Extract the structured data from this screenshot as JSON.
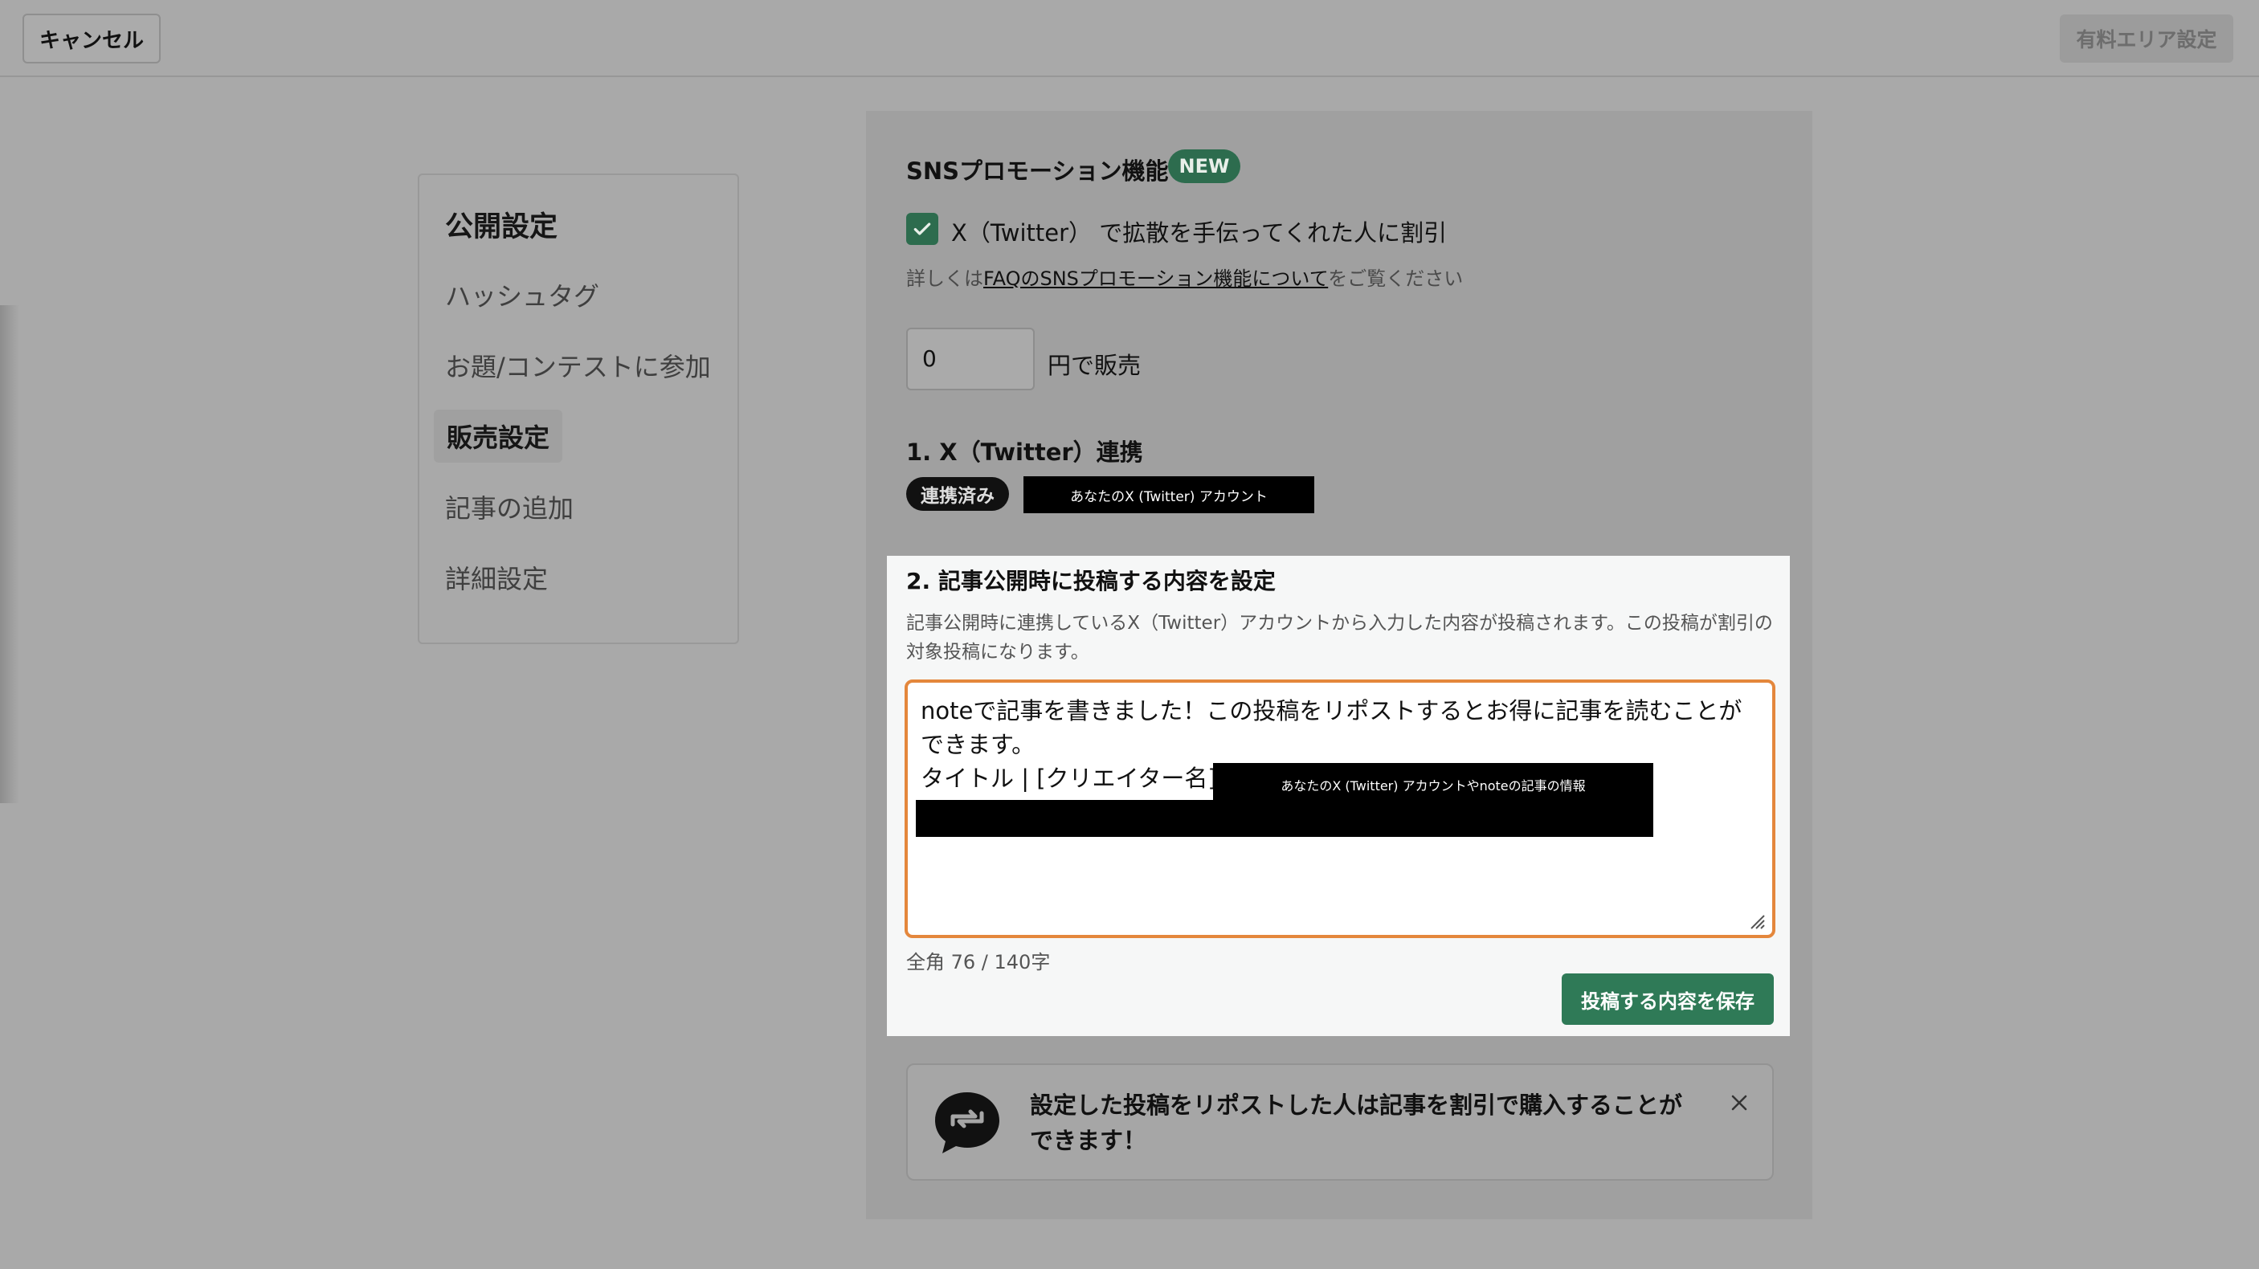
{
  "header": {
    "cancel_label": "キャンセル",
    "paid_area_label": "有料エリア設定"
  },
  "sidebar": {
    "heading": "公開設定",
    "items": [
      {
        "label": "ハッシュタグ"
      },
      {
        "label": "お題/コンテストに参加"
      },
      {
        "label": "販売設定",
        "active": true
      },
      {
        "label": "記事の追加"
      },
      {
        "label": "詳細設定"
      }
    ]
  },
  "sns": {
    "title": "SNSプロモーション機能",
    "badge": "NEW",
    "checkbox_label": "X（Twitter） で拡散を手伝ってくれた人に割引",
    "checkbox_checked": true,
    "faq_prefix": "詳しくは",
    "faq_link": "FAQのSNSプロモーション機能について",
    "faq_suffix": "をご覧ください"
  },
  "price": {
    "value": "0",
    "suffix": "円で販売"
  },
  "step1": {
    "title": "1. X（Twitter）連携",
    "connected_badge": "連携済み",
    "account_redacted": "あなたのX (Twitter) アカウント"
  },
  "step2": {
    "title": "2. 記事公開時に投稿する内容を設定",
    "description": "記事公開時に連携しているX（Twitter）アカウントから入力した内容が投稿されます。この投稿が割引の対象投稿になります。",
    "post_text_line1": "noteで記事を書きました！この投稿をリポストするとお得に記事を読むことができます。",
    "post_text_line2": "タイトル | [クリエイター名]",
    "post_redacted": "あなたのX (Twitter) アカウントやnoteの記事の情報",
    "char_count": "全角 76 / 140字",
    "save_label": "投稿する内容を保存"
  },
  "tip": {
    "text": "設定した投稿をリポストした人は記事を割引で購入することができます！"
  },
  "colors": {
    "accent_green": "#2f7a57",
    "focus_orange": "#e4873c"
  }
}
